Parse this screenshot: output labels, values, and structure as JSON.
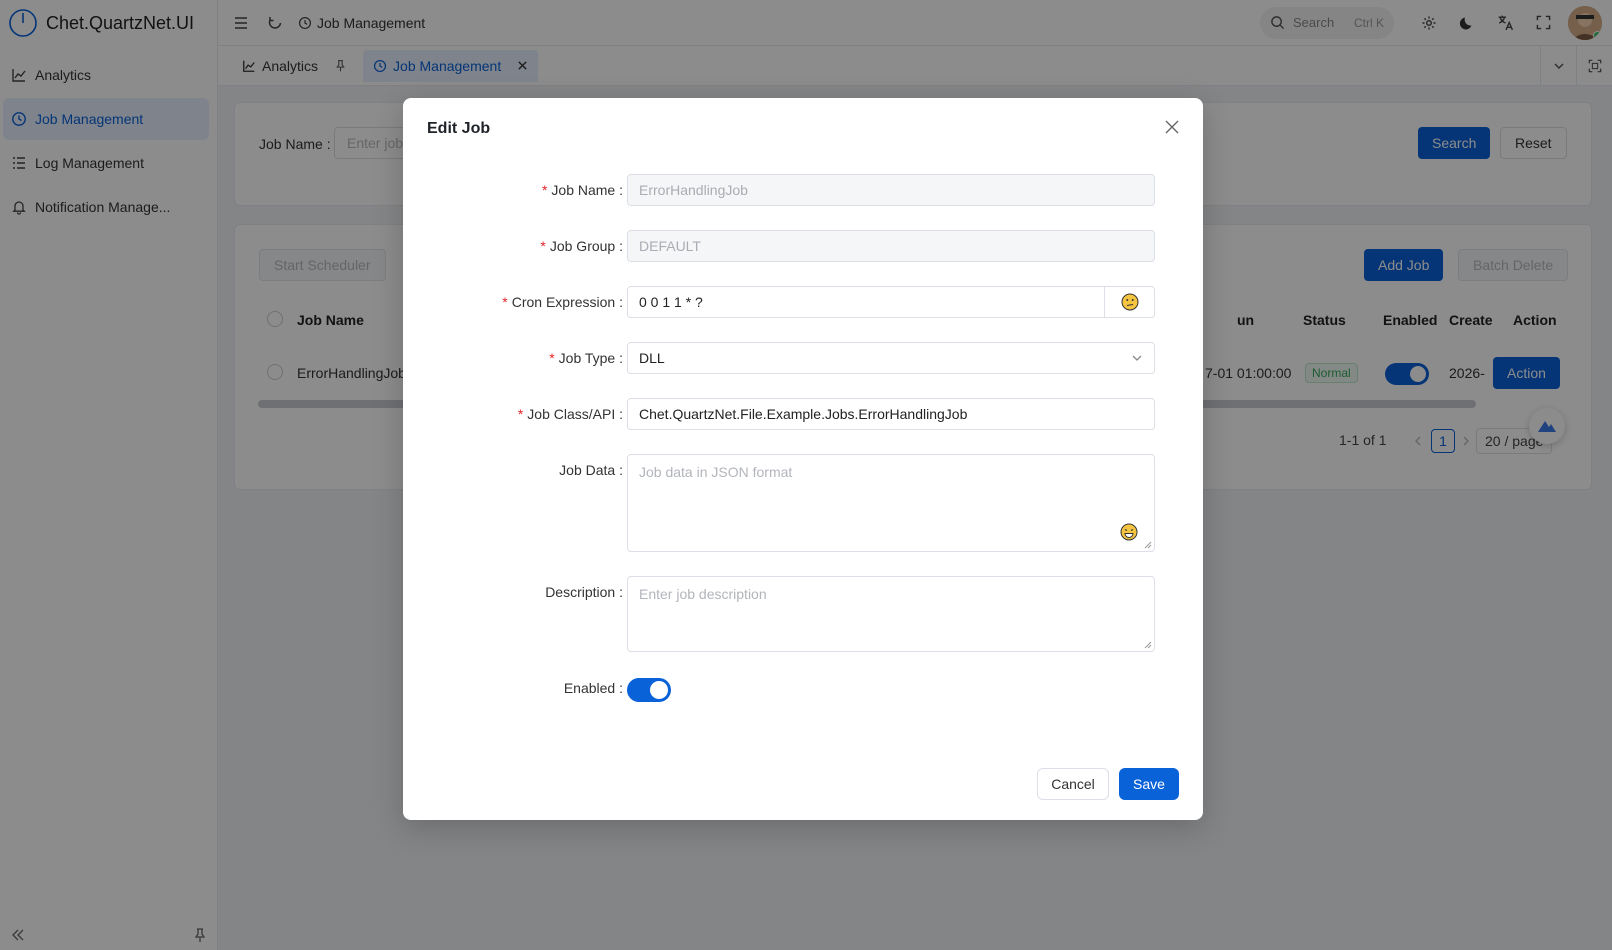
{
  "app": {
    "title": "Chet.QuartzNet.UI"
  },
  "sidebar": {
    "items": [
      {
        "label": "Analytics",
        "icon": "chart-icon"
      },
      {
        "label": "Job Management",
        "icon": "clock-icon",
        "active": true
      },
      {
        "label": "Log Management",
        "icon": "list-icon"
      },
      {
        "label": "Notification Manage...",
        "icon": "bell-icon"
      }
    ]
  },
  "header": {
    "breadcrumb": "Job Management",
    "search_placeholder": "Search",
    "search_shortcut": "Ctrl K"
  },
  "tabs": [
    {
      "label": "Analytics",
      "icon": "chart-icon",
      "pinned": true
    },
    {
      "label": "Job Management",
      "icon": "clock-icon",
      "active": true,
      "closable": true
    }
  ],
  "filter": {
    "job_name_label": "Job Name :",
    "job_name_placeholder": "Enter job",
    "search_button": "Search",
    "reset_button": "Reset"
  },
  "toolbar": {
    "start_scheduler": "Start Scheduler",
    "add_job": "Add Job",
    "batch_delete": "Batch Delete"
  },
  "table": {
    "headers": {
      "job_name": "Job Name",
      "next_run": "un",
      "status": "Status",
      "enabled": "Enabled",
      "created": "Create",
      "action": "Action"
    },
    "row": {
      "job_name": "ErrorHandlingJob",
      "next_run": "7-01 01:00:00",
      "status": "Normal",
      "created": "2026-",
      "action": "Action"
    }
  },
  "pagination": {
    "summary": "1-1 of 1",
    "current_page": "1",
    "page_size": "20 / page"
  },
  "modal": {
    "title": "Edit Job",
    "fields": {
      "job_name": {
        "label": "Job Name :",
        "value": "ErrorHandlingJob"
      },
      "job_group": {
        "label": "Job Group :",
        "value": "DEFAULT"
      },
      "cron": {
        "label": "Cron Expression :",
        "value": "0 0 1 1 * ?"
      },
      "job_type": {
        "label": "Job Type :",
        "value": "DLL"
      },
      "job_class": {
        "label": "Job Class/API :",
        "value": "Chet.QuartzNet.File.Example.Jobs.ErrorHandlingJob"
      },
      "job_data": {
        "label": "Job Data :",
        "placeholder": "Job data in JSON format"
      },
      "description": {
        "label": "Description :",
        "placeholder": "Enter job description"
      },
      "enabled": {
        "label": "Enabled :",
        "value": true
      }
    },
    "cancel_button": "Cancel",
    "save_button": "Save"
  },
  "colors": {
    "primary": "#0a62d8",
    "required": "#e0242a",
    "status_normal": "#3aa85c"
  }
}
